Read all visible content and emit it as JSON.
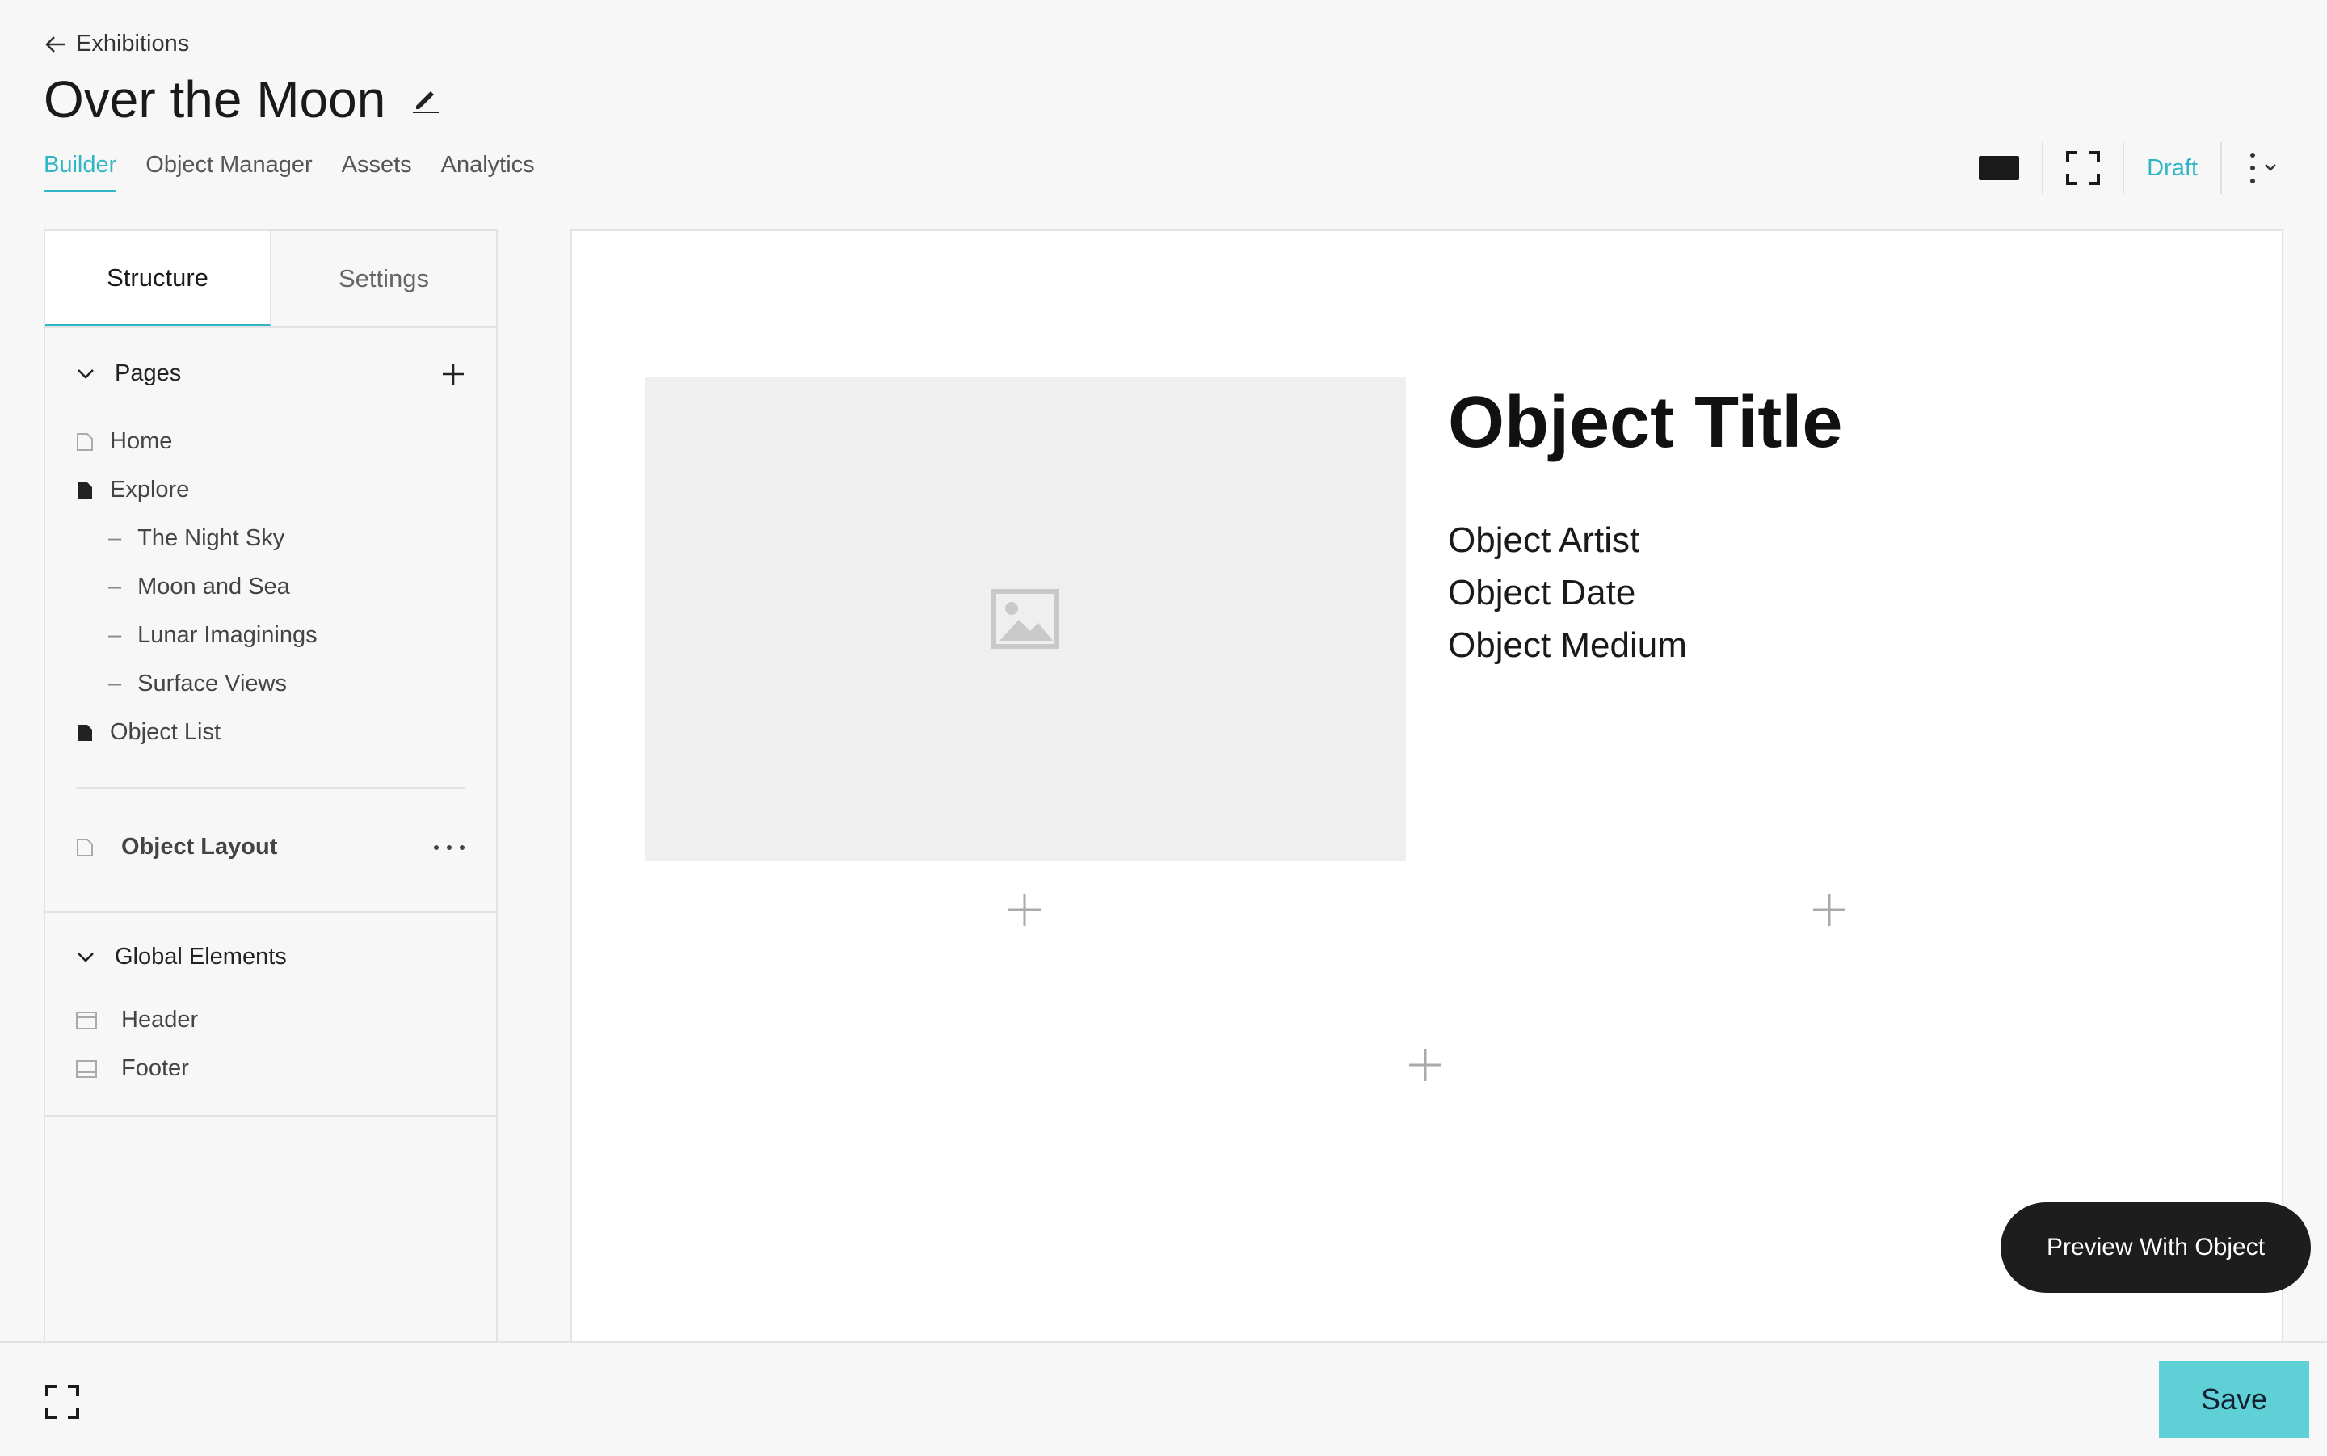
{
  "header": {
    "back_label": "Exhibitions",
    "title": "Over the Moon",
    "tabs": [
      "Builder",
      "Object Manager",
      "Assets",
      "Analytics"
    ],
    "status": "Draft"
  },
  "panel": {
    "tabs": [
      "Structure",
      "Settings"
    ],
    "pages_label": "Pages",
    "pages": [
      {
        "label": "Home",
        "icon": "page-outline-icon"
      },
      {
        "label": "Explore",
        "icon": "page-filled-icon"
      },
      {
        "label": "The Night Sky",
        "icon": "dash"
      },
      {
        "label": "Moon and Sea",
        "icon": "dash"
      },
      {
        "label": "Lunar Imaginings",
        "icon": "dash"
      },
      {
        "label": "Surface Views",
        "icon": "dash"
      },
      {
        "label": "Object List",
        "icon": "page-filled-icon"
      }
    ],
    "object_layout_label": "Object Layout",
    "global_label": "Global Elements",
    "global_items": [
      "Header",
      "Footer"
    ],
    "dash_glyph": "–"
  },
  "canvas": {
    "object_title": "Object Title",
    "object_artist": "Object Artist",
    "object_date": "Object Date",
    "object_medium": "Object Medium"
  },
  "actions": {
    "preview": "Preview With Object",
    "save": "Save"
  },
  "colors": {
    "accent": "#2fb6c4",
    "save_bg": "#5fd0d6",
    "dark": "#1d1d1d"
  }
}
